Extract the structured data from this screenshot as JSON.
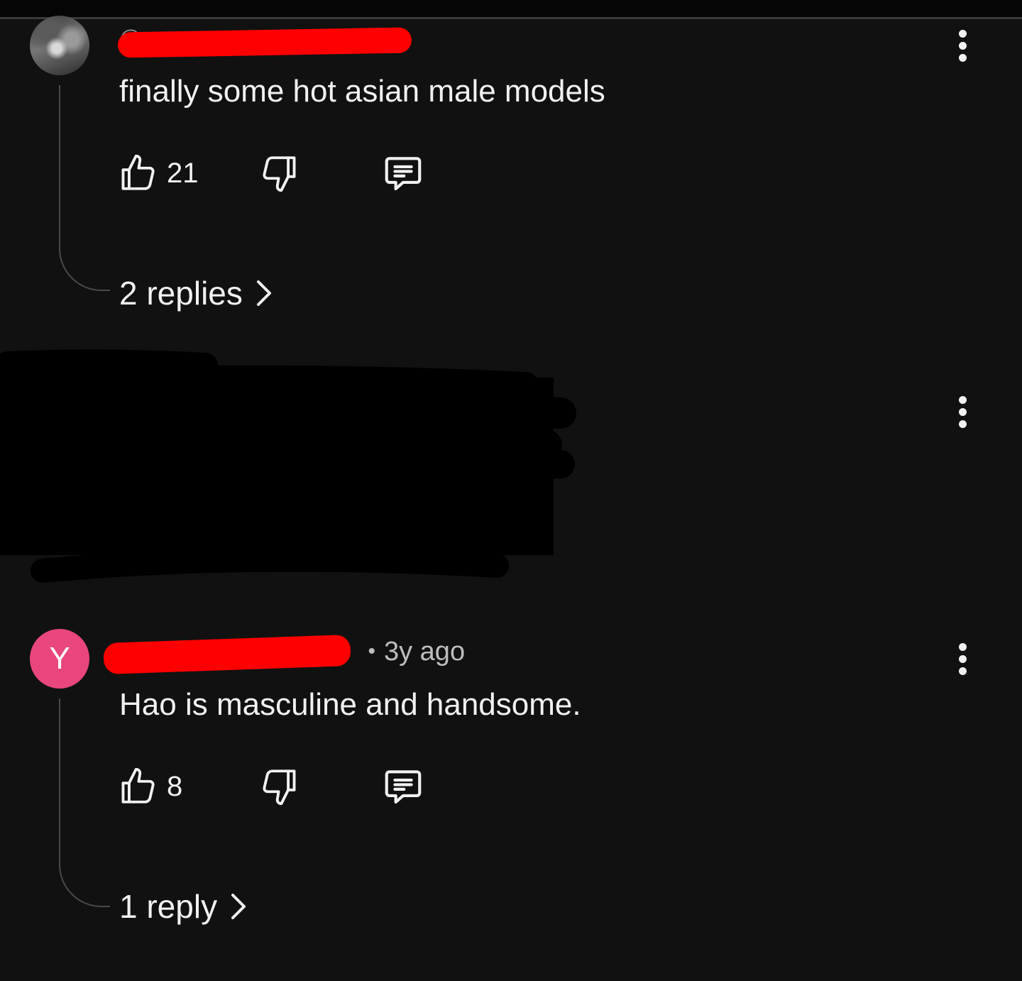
{
  "comments": [
    {
      "avatar_letter": "",
      "author": "@",
      "time": "",
      "text": "finally some hot asian male models",
      "likes": "21",
      "replies_label": "2 replies",
      "avatar_color": ""
    },
    {
      "avatar_letter": "Y",
      "author": "@",
      "time": "3y ago",
      "text": "Hao is masculine and handsome.",
      "likes": "8",
      "replies_label": "1 reply",
      "avatar_color": "#e8467c"
    }
  ],
  "colors": {
    "background": "#111111",
    "text": "#f1f1f1",
    "redaction": "#ff0000"
  },
  "icons": [
    "thumbs-up-icon",
    "thumbs-down-icon",
    "comment-icon",
    "more-vertical-icon",
    "chevron-right-icon"
  ]
}
